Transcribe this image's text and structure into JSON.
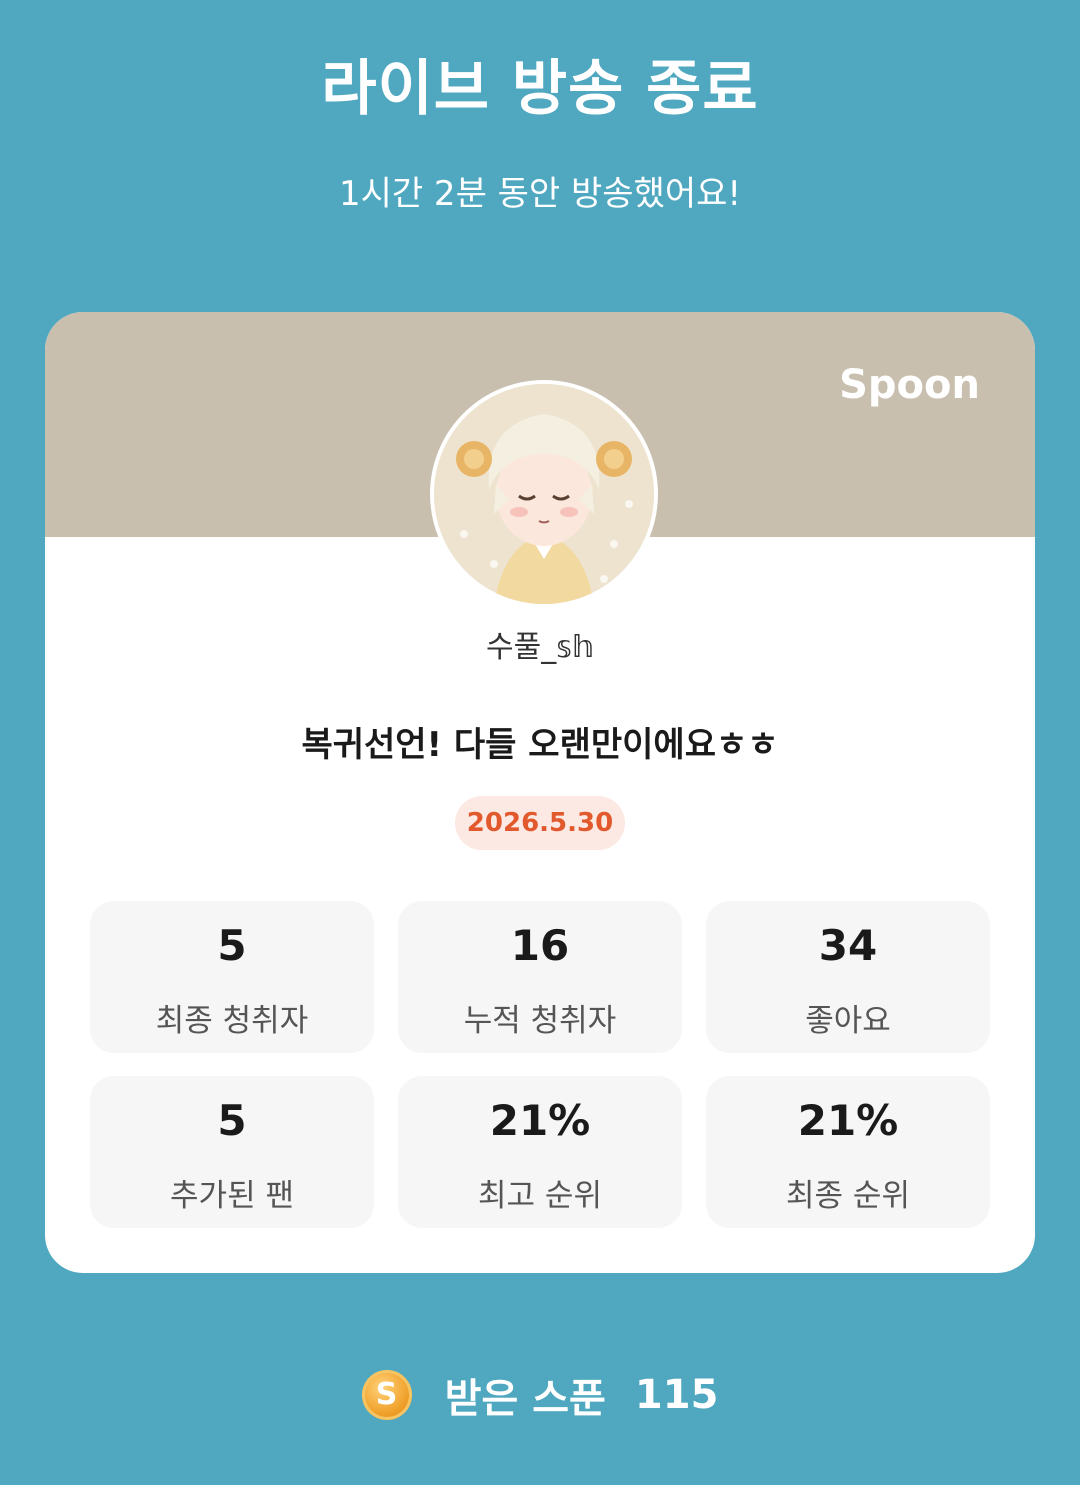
{
  "header": {
    "title": "라이브 방송 종료",
    "subtitle": "1시간 2분 동안 방송했어요!"
  },
  "card": {
    "brand": "Spoon",
    "username": "수풀_𝕤𝕙",
    "broadcast_title": "복귀선언! 다들 오랜만이에요ㅎㅎ",
    "date": "2026.5.30"
  },
  "stats": [
    {
      "value": "5",
      "label": "최종 청취자"
    },
    {
      "value": "16",
      "label": "누적 청취자"
    },
    {
      "value": "34",
      "label": "좋아요"
    },
    {
      "value": "5",
      "label": "추가된 팬"
    },
    {
      "value": "21%",
      "label": "최고 순위"
    },
    {
      "value": "21%",
      "label": "최종 순위"
    }
  ],
  "footer": {
    "coin_icon": "spoon-coin-icon",
    "coin_letter": "S",
    "label": "받은 스푼",
    "count": "115"
  },
  "colors": {
    "background": "#4fa8c0",
    "banner": "#c8bfaf",
    "date_badge_bg": "#fde9e3",
    "date_badge_text": "#e2592d"
  }
}
